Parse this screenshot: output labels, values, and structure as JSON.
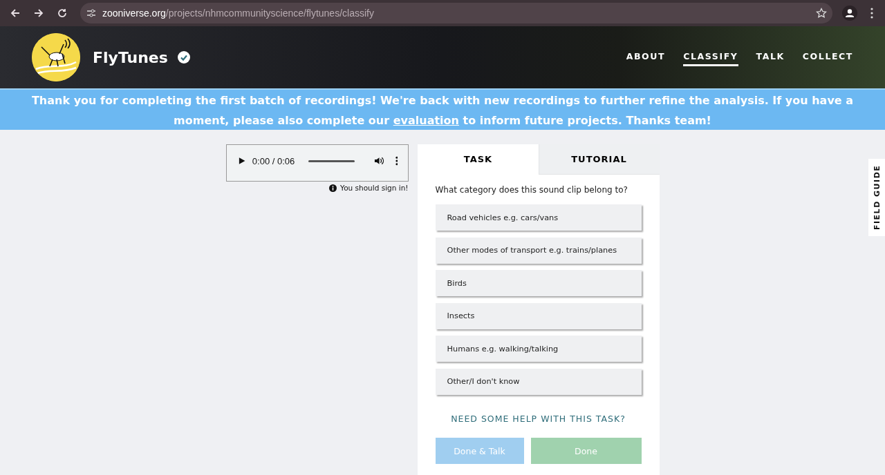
{
  "browser": {
    "url_domain": "zooniverse.org",
    "url_path": "/projects/nhmcommunityscience/flytunes/classify"
  },
  "header": {
    "title": "FlyTunes",
    "verified": true,
    "nav": [
      {
        "label": "ABOUT",
        "selected": false
      },
      {
        "label": "CLASSIFY",
        "selected": true
      },
      {
        "label": "TALK",
        "selected": false
      },
      {
        "label": "COLLECT",
        "selected": false
      }
    ]
  },
  "banner": {
    "text_before": "Thank you for completing the first batch of recordings! We're back with new recordings to further refine the analysis. If you have a moment, please also complete our",
    "link": "evaluation",
    "text_after": "to inform future projects. Thanks team!"
  },
  "audio": {
    "time": "0:00 / 0:06"
  },
  "sign_in_note": "You should sign in!",
  "task_panel": {
    "tabs": [
      {
        "label": "TASK",
        "selected": true
      },
      {
        "label": "TUTORIAL",
        "selected": false
      }
    ],
    "question": "What category does this sound clip belong to?",
    "answers": [
      {
        "label": "Road vehicles e.g. cars/vans",
        "selected": false
      },
      {
        "label": "Other modes of transport e.g. trains/planes",
        "selected": false
      },
      {
        "label": "Birds",
        "selected": false
      },
      {
        "label": "Insects",
        "selected": false
      },
      {
        "label": "Humans e.g. walking/talking",
        "selected": false
      },
      {
        "label": "Other/I don't know",
        "selected": false
      }
    ],
    "help_link": "NEED SOME HELP WITH THIS TASK?",
    "buttons": [
      {
        "label": "Done & Talk",
        "kind": "talk",
        "disabled": true
      },
      {
        "label": "Done",
        "kind": "done",
        "disabled": true
      }
    ]
  },
  "field_guide": "FIELD GUIDE"
}
